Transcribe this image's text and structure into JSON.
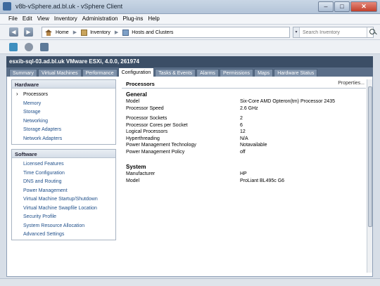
{
  "window": {
    "title": "v8b-vSphere.ad.bl.uk - vSphere Client"
  },
  "menubar": [
    "File",
    "Edit",
    "View",
    "Inventory",
    "Administration",
    "Plug-ins",
    "Help"
  ],
  "navbar": {
    "breadcrumb": [
      "Home",
      "Inventory",
      "Hosts and Clusters"
    ],
    "search_placeholder": "Search Inventory"
  },
  "host": {
    "title": "esxib-sql-03.ad.bl.uk VMware ESXi, 4.0.0, 261974"
  },
  "tabs": [
    "Summary",
    "Virtual Machines",
    "Performance",
    "Configuration",
    "Tasks & Events",
    "Alarms",
    "Permissions",
    "Maps",
    "Hardware Status"
  ],
  "hardware": {
    "header": "Hardware",
    "items": [
      "Processors",
      "Memory",
      "Storage",
      "Networking",
      "Storage Adapters",
      "Network Adapters"
    ]
  },
  "software": {
    "header": "Software",
    "items": [
      "Licensed Features",
      "Time Configuration",
      "DNS and Routing",
      "Power Management",
      "Virtual Machine Startup/Shutdown",
      "Virtual Machine Swapfile Location",
      "Security Profile",
      "System Resource Allocation",
      "Advanced Settings"
    ]
  },
  "main": {
    "title": "Processors",
    "properties_link": "Properties...",
    "general_header": "General",
    "general": [
      {
        "k": "Model",
        "v": "Six-Core AMD Opteron(tm) Processor 2435"
      },
      {
        "k": "Processor Speed",
        "v": "2.6 GHz"
      }
    ],
    "general2": [
      {
        "k": "Processor Sockets",
        "v": "2"
      },
      {
        "k": "Processor Cores per Socket",
        "v": "6"
      },
      {
        "k": "Logical Processors",
        "v": "12"
      },
      {
        "k": "Hyperthreading",
        "v": "N/A"
      },
      {
        "k": "Power Management Technology",
        "v": "Notavailable"
      },
      {
        "k": "Power Management Policy",
        "v": "off"
      }
    ],
    "system_header": "System",
    "system": [
      {
        "k": "Manufacturer",
        "v": "HP"
      },
      {
        "k": "Model",
        "v": "ProLiant BL495c G6"
      }
    ]
  },
  "colors": {
    "accent": "#3b4e66",
    "link": "#1f4f8a"
  }
}
